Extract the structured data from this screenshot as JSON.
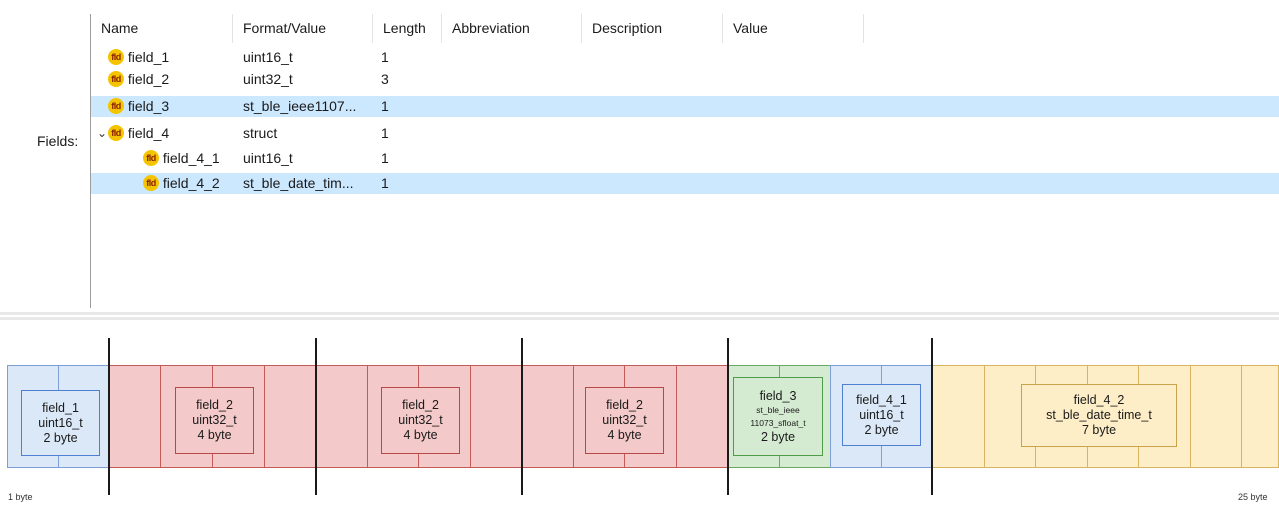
{
  "fields_label": "Fields:",
  "columns": [
    "Name",
    "Format/Value",
    "Length",
    "Abbreviation",
    "Description",
    "Value"
  ],
  "rows": [
    {
      "icon": "fld",
      "name": "field_1",
      "format": "uint16_t",
      "length": "1",
      "selected": false,
      "expand": ""
    },
    {
      "icon": "fld",
      "name": "field_2",
      "format": "uint32_t",
      "length": "3",
      "selected": false,
      "expand": ""
    },
    {
      "icon": "fld",
      "name": "field_3",
      "format": "st_ble_ieee1107...",
      "length": "1",
      "selected": true,
      "expand": ""
    },
    {
      "icon": "fld",
      "name": "field_4",
      "format": "struct",
      "length": "1",
      "selected": false,
      "expand": "⌄"
    },
    {
      "icon": "fld",
      "name": "field_4_1",
      "format": "uint16_t",
      "length": "1",
      "selected": false,
      "expand": ""
    },
    {
      "icon": "fld",
      "name": "field_4_2",
      "format": "st_ble_date_tim...",
      "length": "1",
      "selected": true,
      "expand": ""
    }
  ],
  "diagram": {
    "blocks": [
      {
        "lines": [
          "field_1",
          "uint16_t",
          "2 byte"
        ],
        "color": "blue"
      },
      {
        "lines": [
          "field_2",
          "uint32_t",
          "4 byte"
        ],
        "color": "red"
      },
      {
        "lines": [
          "field_2",
          "uint32_t",
          "4 byte"
        ],
        "color": "red"
      },
      {
        "lines": [
          "field_2",
          "uint32_t",
          "4 byte"
        ],
        "color": "red"
      },
      {
        "lines": [
          "field_3",
          "st_ble_ieee",
          "11073_sfloat_t",
          "2 byte"
        ],
        "color": "green"
      },
      {
        "lines": [
          "field_4_1",
          "uint16_t",
          "2 byte"
        ],
        "color": "blue"
      },
      {
        "lines": [
          "field_4_2",
          "st_ble_date_time_t",
          "7 byte"
        ],
        "color": "yellow"
      }
    ],
    "scale_start": "1 byte",
    "scale_end": "25 byte",
    "colors": {
      "blue": "#dbe8f7",
      "red": "#f4c9c9",
      "green": "#d4ebd1",
      "yellow": "#fdeec7"
    }
  }
}
